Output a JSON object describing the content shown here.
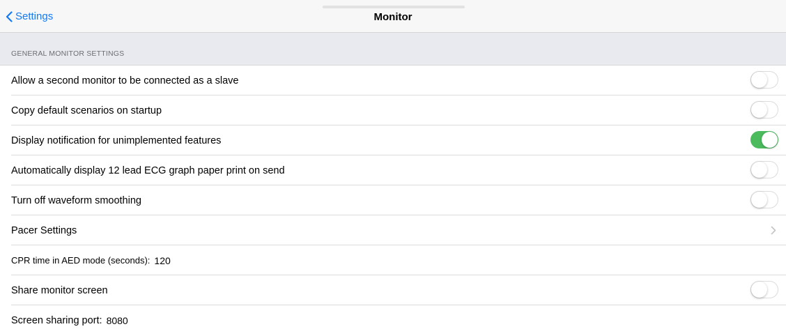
{
  "nav": {
    "back_label": "Settings",
    "title": "Monitor"
  },
  "section": {
    "header": "GENERAL MONITOR SETTINGS"
  },
  "rows": [
    {
      "label": "Allow a second monitor to be connected as a slave",
      "toggle": false
    },
    {
      "label": "Copy default scenarios on startup",
      "toggle": false
    },
    {
      "label": "Display notification for unimplemented features",
      "toggle": true
    },
    {
      "label": "Automatically display 12 lead ECG graph paper print on send",
      "toggle": false
    },
    {
      "label": "Turn off waveform smoothing",
      "toggle": false
    },
    {
      "label": "Pacer Settings"
    },
    {
      "label": "CPR time in AED mode (seconds):",
      "value": "120"
    },
    {
      "label": "Share monitor screen",
      "toggle": false
    },
    {
      "label": "Screen sharing port:",
      "value": "8080"
    }
  ],
  "colors": {
    "accent": "#1479f4",
    "toggle_on": "#4bbb5d"
  },
  "icons": {
    "back": "chevron-left-icon",
    "disclosure": "chevron-right-icon"
  }
}
